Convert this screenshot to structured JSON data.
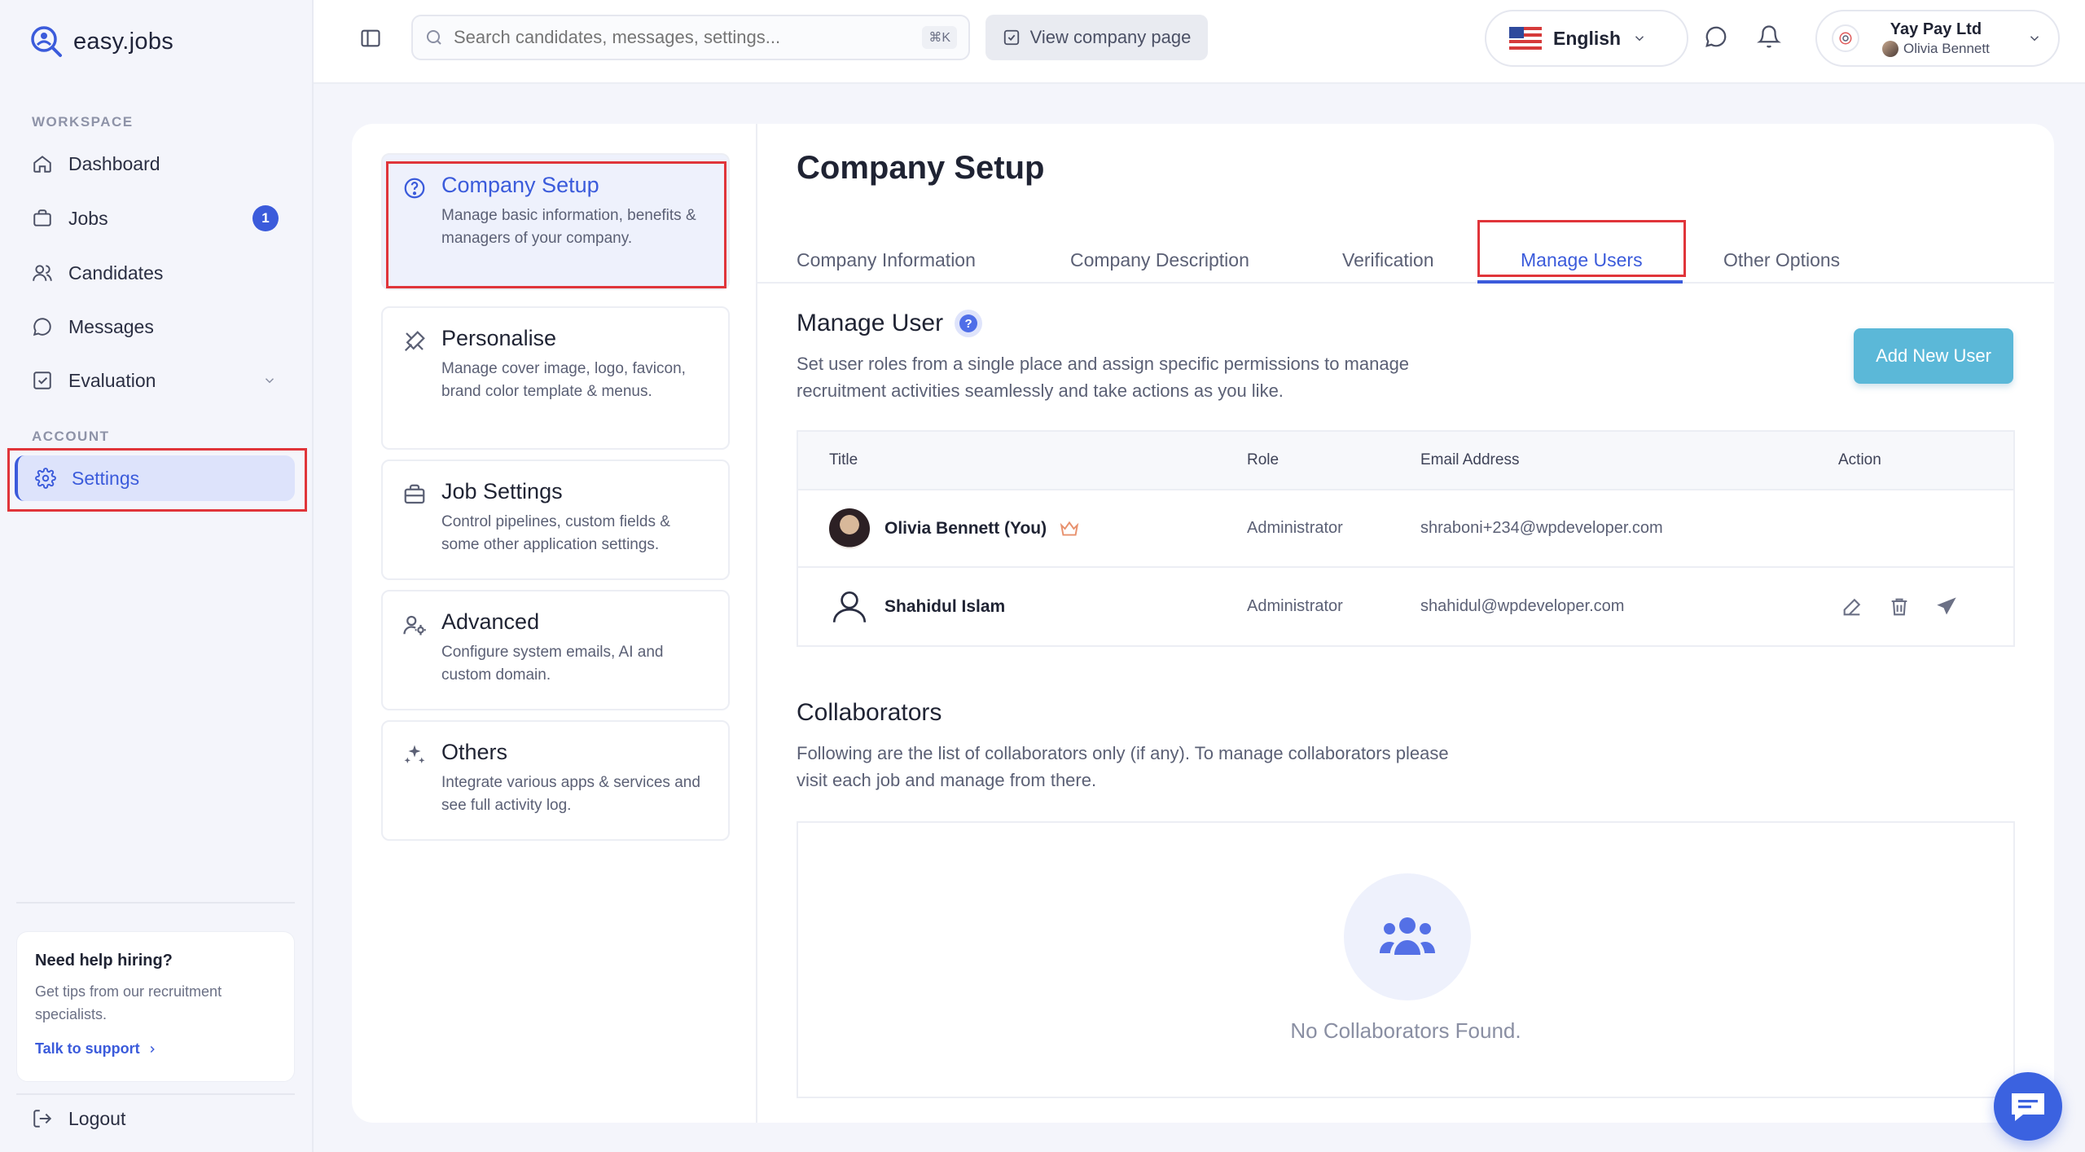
{
  "brand": {
    "name": "easy.jobs"
  },
  "sidebar": {
    "workspace_label": "WORKSPACE",
    "account_label": "ACCOUNT",
    "items": [
      {
        "label": "Dashboard"
      },
      {
        "label": "Jobs",
        "badge": "1"
      },
      {
        "label": "Candidates"
      },
      {
        "label": "Messages"
      },
      {
        "label": "Evaluation"
      },
      {
        "label": "Settings"
      }
    ],
    "help": {
      "title": "Need help hiring?",
      "text": "Get tips from our recruitment specialists.",
      "link": "Talk to support"
    },
    "logout": "Logout"
  },
  "topbar": {
    "search_placeholder": "Search candidates, messages, settings...",
    "shortcut": "⌘K",
    "view_company": "View company page",
    "language": "English",
    "company_name": "Yay Pay Ltd",
    "user_name": "Olivia Bennett"
  },
  "settings_menu": [
    {
      "title": "Company Setup",
      "desc": "Manage basic information, benefits & managers of your company."
    },
    {
      "title": "Personalise",
      "desc": "Manage cover image, logo, favicon, brand color template & menus."
    },
    {
      "title": "Job Settings",
      "desc": "Control pipelines, custom fields & some other application settings."
    },
    {
      "title": "Advanced",
      "desc": "Configure system emails, AI and custom domain."
    },
    {
      "title": "Others",
      "desc": "Integrate various apps & services and see full activity log."
    }
  ],
  "main": {
    "title": "Company Setup",
    "tabs": [
      "Company Information",
      "Company Description",
      "Verification",
      "Manage Users",
      "Other Options"
    ],
    "active_tab": "Manage Users",
    "manage_user": {
      "title": "Manage User",
      "help_icon": "?",
      "description": "Set user roles from a single place and assign specific permissions to manage recruitment activities seamlessly and take actions as you like.",
      "add_button": "Add New User",
      "columns": [
        "Title",
        "Role",
        "Email Address",
        "Action"
      ],
      "rows": [
        {
          "name": "Olivia Bennett (You)",
          "role": "Administrator",
          "email": "shraboni+234@wpdeveloper.com"
        },
        {
          "name": "Shahidul Islam",
          "role": "Administrator",
          "email": "shahidul@wpdeveloper.com"
        }
      ]
    },
    "collaborators": {
      "title": "Collaborators",
      "description": "Following are the list of collaborators only (if any). To manage collaborators please visit each job and manage from there.",
      "empty": "No Collaborators Found."
    }
  },
  "colors": {
    "accent": "#3b5bdb",
    "add_button": "#5bb8d8",
    "highlight": "#e0353a"
  }
}
